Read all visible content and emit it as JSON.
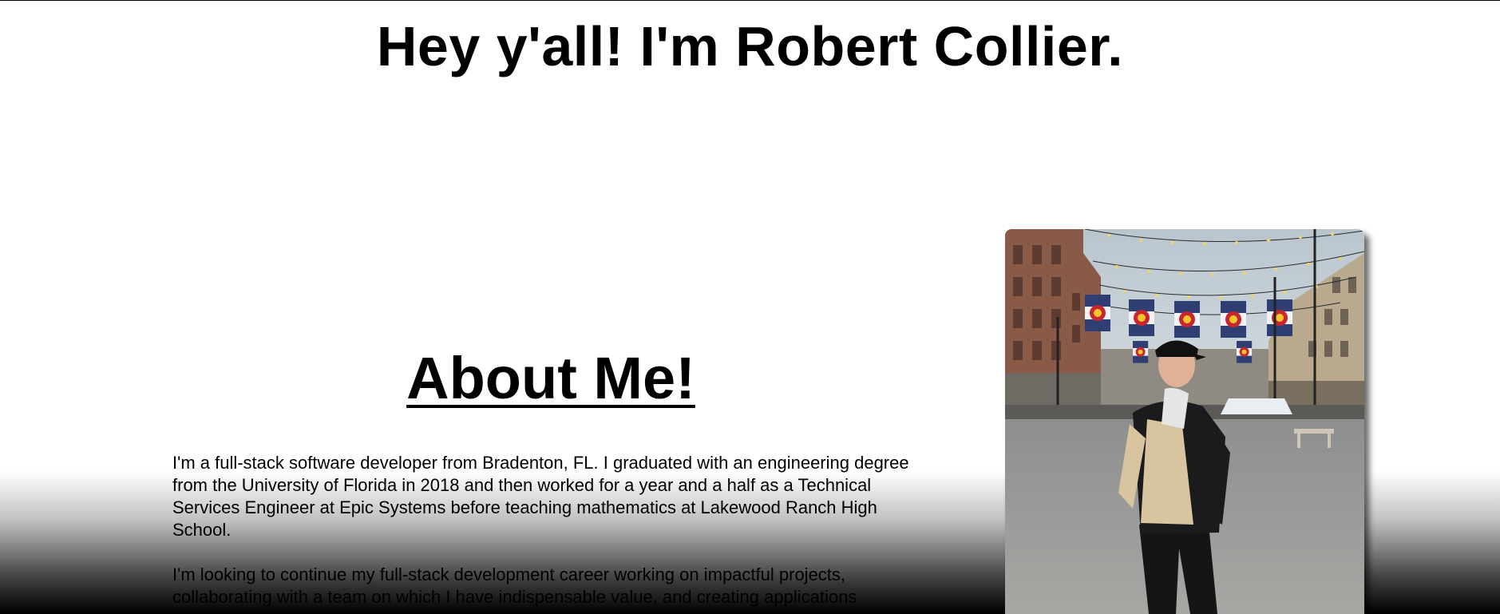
{
  "hero": {
    "title": "Hey y'all! I'm Robert Collier."
  },
  "about": {
    "heading": "About Me!",
    "paragraphs": [
      "I'm a full-stack software developer from Bradenton, FL. I graduated with an engineering degree from the University of Florida in 2018 and then worked for a year and a half as a Technical Services Engineer at Epic Systems before teaching mathematics at Lakewood Ranch High School.",
      "I'm looking to continue my full-stack development career working on impactful projects, collaborating with a team on which I have indispensable value, and creating applications"
    ]
  },
  "photo": {
    "icon": "profile-photo",
    "colors": {
      "sky": "#c9d3da",
      "street": "#9b9a98",
      "brick": "#8a5a48",
      "jacket_light": "#d9c4a0",
      "jacket_dark": "#1b1b1d"
    }
  }
}
